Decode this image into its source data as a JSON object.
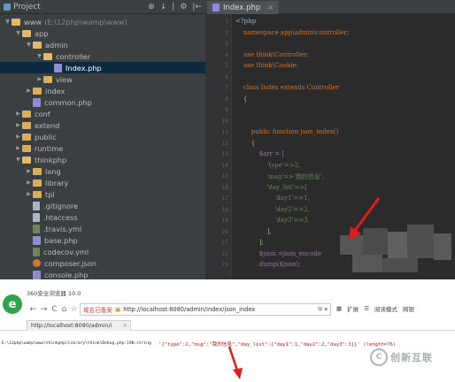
{
  "colors": {
    "ide_bg": "#2b2b2b",
    "panel_bg": "#3c3f41",
    "selection": "#0d293e",
    "arrow": "#e01b1b",
    "browser_logo": "#2fa24c"
  },
  "project_panel": {
    "title": "Project",
    "tools": [
      "⊕",
      "↓",
      "|",
      "⚙",
      "|←"
    ],
    "tree": [
      {
        "label": "www",
        "hint": "(E:\\12php\\wamp\\www)",
        "type": "folder",
        "open": true,
        "depth": 0
      },
      {
        "label": "app",
        "type": "folder",
        "open": true,
        "depth": 1
      },
      {
        "label": "admin",
        "type": "folder",
        "open": true,
        "depth": 2
      },
      {
        "label": "controller",
        "type": "folder",
        "open": true,
        "depth": 3
      },
      {
        "label": "Index.php",
        "type": "php",
        "depth": 4,
        "selected": true
      },
      {
        "label": "view",
        "type": "folder",
        "open": false,
        "depth": 3
      },
      {
        "label": "index",
        "type": "folder",
        "open": false,
        "depth": 2
      },
      {
        "label": "common.php",
        "type": "php",
        "depth": 2
      },
      {
        "label": "conf",
        "type": "folder",
        "open": false,
        "depth": 1
      },
      {
        "label": "extend",
        "type": "folder",
        "open": false,
        "depth": 1
      },
      {
        "label": "public",
        "type": "folder",
        "open": false,
        "depth": 1
      },
      {
        "label": "runtime",
        "type": "folder",
        "open": false,
        "depth": 1
      },
      {
        "label": "thinkphp",
        "type": "folder",
        "open": true,
        "depth": 1
      },
      {
        "label": "lang",
        "type": "folder",
        "open": false,
        "depth": 2
      },
      {
        "label": "library",
        "type": "folder",
        "open": false,
        "depth": 2
      },
      {
        "label": "tpl",
        "type": "folder",
        "open": false,
        "depth": 2
      },
      {
        "label": ".gitignore",
        "type": "gen",
        "depth": 2
      },
      {
        "label": ".htaccess",
        "type": "gen",
        "depth": 2
      },
      {
        "label": ".travis.yml",
        "type": "yml",
        "depth": 2
      },
      {
        "label": "base.php",
        "type": "php",
        "depth": 2
      },
      {
        "label": "codecov.yml",
        "type": "yml",
        "depth": 2
      },
      {
        "label": "composer.json",
        "type": "json",
        "depth": 2
      },
      {
        "label": "console.php",
        "type": "php",
        "depth": 2
      }
    ]
  },
  "editor": {
    "tab_label": "Index.php",
    "line_numbers": [
      "1",
      "2",
      "3",
      "4",
      "5",
      "6",
      "7",
      "8",
      "9",
      "10",
      "11",
      "12",
      "13",
      "14",
      "15",
      "16",
      "17",
      "18",
      "19",
      "20",
      "21",
      "22",
      "23"
    ],
    "lines": [
      "<?php",
      "    namespace app\\admin\\controller;",
      "",
      "    use think\\Controller;",
      "    use think\\Cookie;",
      "",
      "    class Index extends Controller",
      "    {",
      "",
      "",
      "        public function json_index()",
      "        {",
      "            $arr = [",
      "                'type'=>2,",
      "                'msg'=>'我的信息',",
      "                'day_list'=>[",
      "                    'day1'=>1,",
      "                    'day2'=>2,",
      "                    'day3'=>3,",
      "                ],",
      "            ];",
      "            $json =json_encode",
      "            dump($json);"
    ]
  },
  "browser": {
    "title": "360安全浏览器 10.0",
    "logo_letter": "e",
    "nav": [
      "←",
      "→",
      "C",
      "⌂",
      "☆"
    ],
    "safe_label": "域名已备案",
    "url": "http://localhost:8080/admin/index/json_index",
    "right_items": [
      "扩展",
      "阅读模式",
      "网银"
    ],
    "tab_label": "http://localhost:8080/admin/i",
    "output_path": "E:\\12php\\wamp\\www\\thinkphp\\library\\think\\Debug.php:190:string",
    "output_json": "'{\"type\":2,\"msg\":\"我的信息\",\"day_list\":{\"day1\":1,\"day2\":2,\"day3\":3}}' (length=76)"
  },
  "watermark": {
    "logo": "C",
    "text": "创新互联"
  }
}
